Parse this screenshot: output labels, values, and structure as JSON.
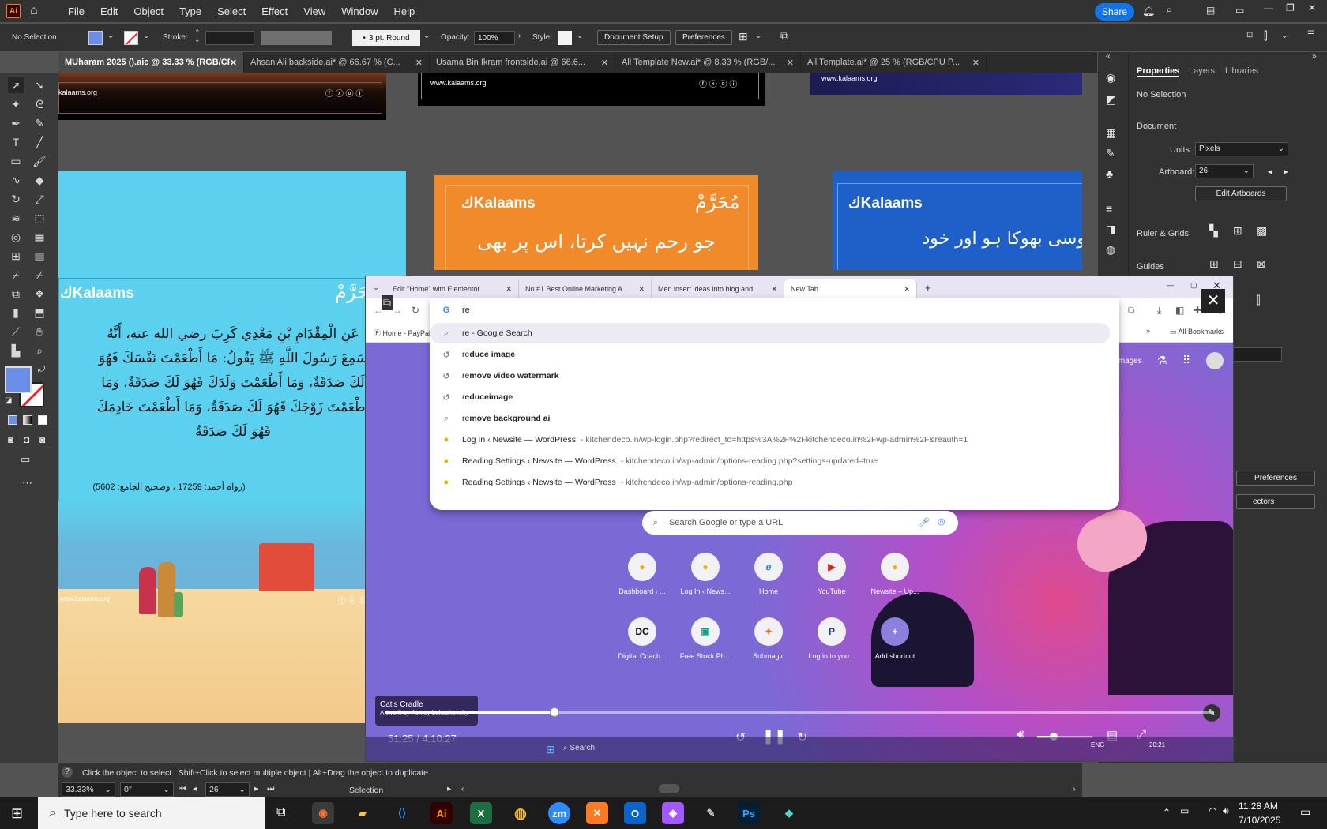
{
  "app": {
    "logo": "Ai"
  },
  "menu": [
    "File",
    "Edit",
    "Object",
    "Type",
    "Select",
    "Effect",
    "View",
    "Window",
    "Help"
  ],
  "share": "Share",
  "control": {
    "selection": "No Selection",
    "stroke_label": "Stroke:",
    "brush": "3 pt. Round",
    "opacity_label": "Opacity:",
    "opacity": "100%",
    "style_label": "Style:",
    "doc_setup": "Document Setup",
    "preferences": "Preferences"
  },
  "doc_tabs": [
    "MUharam 2025 ().aic @ 33.33 % (RGB/CPU Preview)",
    "Ahsan Ali backside.ai* @ 66.67 % (C...",
    "Usama Bin Ikram frontside.ai @ 66.6...",
    "All Template New.ai* @ 8.33 % (RGB/...",
    "All Template.ai* @ 25 % (RGB/CPU P..."
  ],
  "artboards": {
    "url1": "kalaams.org",
    "url2": "www.kalaams.org",
    "url3": "www.kalaams.org",
    "brand": "Kalaams",
    "muharram": "مُحَرَّمْ",
    "urdu1_line1": "جو رحم نہیں کرتا، اس پر بھی",
    "urdu2_line1": "وسی بھوکا ہو اور خود",
    "hadith_l1": "عَنِ الْمِقْدَامِ بْنِ مَعْدِي كَرِبَ رضي الله عنه، أَنَّهُ",
    "hadith_l2": "سَمِعَ رَسُولَ اللَّهِ ﷺ يَقُولُ: مَا أَطْعَمْتَ نَفْسَكَ فَهُوَ",
    "hadith_l3": "لَكَ صَدَقَةٌ، وَمَا أَطْعَمْتَ وَلَدَكَ فَهُوَ لَكَ صَدَقَةٌ، وَمَا",
    "hadith_l4": "أَطْعَمْتَ زَوْجَكَ فَهُوَ لَكَ صَدَقَةٌ، وَمَا أَطْعَمْتَ خَادِمَكَ",
    "hadith_l5": "فَهُوَ لَكَ صَدَقَةٌ",
    "reference": "(رواہ أحمد: 17259 ، وصحیح الجامع: 5602)",
    "url4": "www.kalaams.org"
  },
  "properties": {
    "tabs": [
      "Properties",
      "Layers",
      "Libraries"
    ],
    "no_selection": "No Selection",
    "document": "Document",
    "units_label": "Units:",
    "units": "Pixels",
    "artboard_label": "Artboard:",
    "artboard": "26",
    "edit_artboards": "Edit Artboards",
    "ruler_grids": "Ruler & Grids",
    "guides": "Guides",
    "preferences": "Preferences",
    "vectors": "ectors"
  },
  "status": {
    "hint": "Click the object to select  |  Shift+Click to select multiple object  |  Alt+Drag the object to duplicate",
    "zoom": "33.33%",
    "rotate": "0°",
    "artboard": "26",
    "mode": "Selection"
  },
  "browser": {
    "tabs": [
      "Edit \"Home\" with Elementor",
      "No #1 Best Online Marketing A",
      "Men insert ideas into blog and",
      "New Tab"
    ],
    "query": "re",
    "bookmark": "Home - PayPal",
    "all_bookmarks": "All Bookmarks",
    "images": "Images",
    "suggestions": [
      {
        "icon": "search",
        "bold": "",
        "text": "re - Google Search",
        "url": ""
      },
      {
        "icon": "history",
        "bold": "duce image",
        "text": "re",
        "url": ""
      },
      {
        "icon": "history",
        "bold": "move video watermark",
        "text": "re",
        "url": ""
      },
      {
        "icon": "history",
        "bold": "duceimage",
        "text": "re",
        "url": ""
      },
      {
        "icon": "search",
        "bold": "move background ai",
        "text": "re",
        "url": ""
      },
      {
        "icon": "site",
        "bold": "",
        "text": "Log In ‹ Newsite — WordPress",
        "url": "- kitchendeco.in/wp-login.php?redirect_to=https%3A%2F%2Fkitchendeco.in%2Fwp-admin%2F&reauth=1"
      },
      {
        "icon": "site",
        "bold": "",
        "text": "Reading Settings ‹ Newsite — WordPress",
        "url": "- kitchendeco.in/wp-admin/options-reading.php?settings-updated=true"
      },
      {
        "icon": "site",
        "bold": "",
        "text": "Reading Settings ‹ Newsite — WordPress",
        "url": "- kitchendeco.in/wp-admin/options-reading.php"
      }
    ],
    "search_placeholder": "Search Google or type a URL",
    "shortcuts": [
      "Dashboard ‹ ...",
      "Log In ‹ News...",
      "Home",
      "YouTube",
      "Newsite – Up...",
      "Digital Coach...",
      "Free Stock Ph...",
      "Submagic",
      "Log in to you...",
      "Add shortcut"
    ],
    "artwork_title": "Cat's Cradle",
    "artwork_credit": "Artwork by Ashley Lukashevsky",
    "time": "51:25 / 4:10:27",
    "video_progress": 0.205,
    "inner_search": "Search",
    "inner_lang": "ENG",
    "inner_time": "20:21"
  },
  "taskbar": {
    "search": "Type here to search",
    "time": "11:28 AM",
    "date": "7/10/2025",
    "apps": [
      "firefox",
      "file-explorer",
      "vscode",
      "illustrator",
      "excel",
      "chrome",
      "zoom",
      "xampp",
      "outlook",
      "figma",
      "pen",
      "photoshop",
      "app"
    ]
  },
  "colors": {
    "accent": "#1473e6",
    "fill_swatch": "#6b8ee8",
    "cyan_art": "#5bd0ef",
    "orange_art": "#f08a2a",
    "blue_art": "#1e5fc8"
  }
}
